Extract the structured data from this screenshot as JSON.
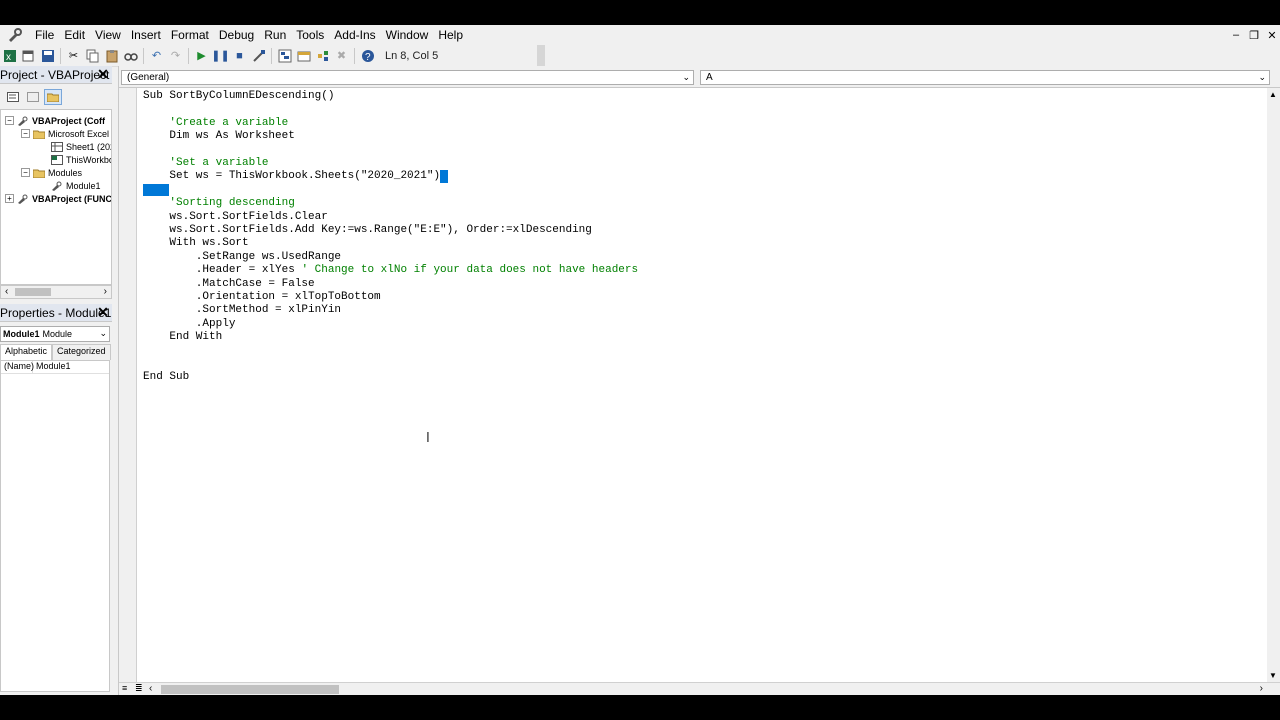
{
  "menu": [
    "File",
    "Edit",
    "View",
    "Insert",
    "Format",
    "Debug",
    "Run",
    "Tools",
    "Add-Ins",
    "Window",
    "Help"
  ],
  "toolbar": {
    "status": "Ln 8, Col 5"
  },
  "project": {
    "title": "Project - VBAProject",
    "nodes": [
      {
        "label": "VBAProject (Coff",
        "bold": true
      },
      {
        "label": "Microsoft Excel",
        "bold": false
      },
      {
        "label": "Sheet1 (202",
        "bold": false
      },
      {
        "label": "ThisWorkbo",
        "bold": false
      },
      {
        "label": "Modules",
        "bold": false
      },
      {
        "label": "Module1",
        "bold": false
      },
      {
        "label": "VBAProject (FUNC",
        "bold": true
      }
    ]
  },
  "properties": {
    "title": "Properties - Module1",
    "object_name": "Module1",
    "object_type": "Module",
    "tabs": [
      "Alphabetic",
      "Categorized"
    ],
    "rows": [
      {
        "key": "(Name)",
        "value": "Module1"
      }
    ]
  },
  "code_window": {
    "object_combo": "(General)",
    "proc_combo": "A",
    "lines": [
      {
        "text": "Sub SortByColumnEDescending()",
        "comment": ""
      },
      {
        "text": "",
        "comment": ""
      },
      {
        "text": "    ",
        "comment": "'Create a variable"
      },
      {
        "text": "    Dim ws As Worksheet",
        "comment": ""
      },
      {
        "text": "",
        "comment": ""
      },
      {
        "text": "    ",
        "comment": "'Set a variable"
      },
      {
        "text": "    Set ws = ThisWorkbook.Sheets(\"2020_2021\")",
        "comment": ""
      },
      {
        "text": "",
        "comment": ""
      },
      {
        "text": "    ",
        "comment": "'Sorting descending"
      },
      {
        "text": "    ws.Sort.SortFields.Clear",
        "comment": ""
      },
      {
        "text": "    ws.Sort.SortFields.Add Key:=ws.Range(\"E:E\"), Order:=xlDescending",
        "comment": ""
      },
      {
        "text": "    With ws.Sort",
        "comment": ""
      },
      {
        "text": "        .SetRange ws.UsedRange",
        "comment": ""
      },
      {
        "text": "        .Header = xlYes ",
        "comment": "' Change to xlNo if your data does not have headers"
      },
      {
        "text": "        .MatchCase = False",
        "comment": ""
      },
      {
        "text": "        .Orientation = xlTopToBottom",
        "comment": ""
      },
      {
        "text": "        .SortMethod = xlPinYin",
        "comment": ""
      },
      {
        "text": "        .Apply",
        "comment": ""
      },
      {
        "text": "    End With",
        "comment": ""
      },
      {
        "text": "",
        "comment": ""
      },
      {
        "text": "",
        "comment": ""
      },
      {
        "text": "End Sub",
        "comment": ""
      }
    ]
  }
}
